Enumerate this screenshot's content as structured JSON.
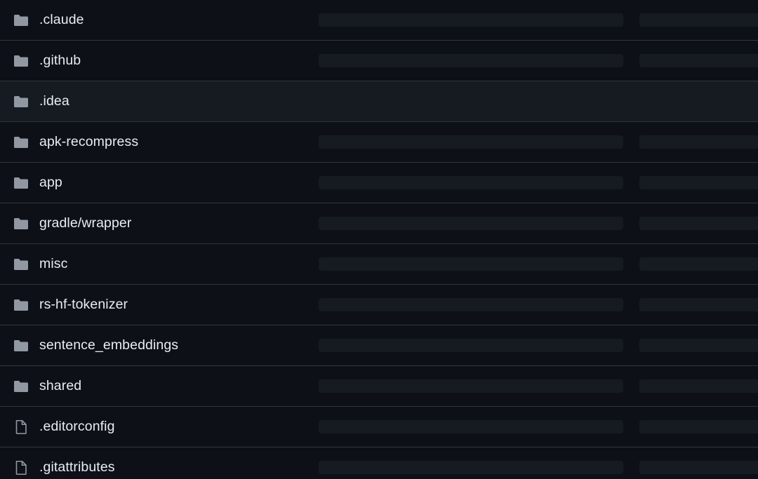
{
  "file_list": {
    "rows": [
      {
        "name": ".claude",
        "type": "folder",
        "icon": "folder-icon",
        "loading": true
      },
      {
        "name": ".github",
        "type": "folder",
        "icon": "folder-icon",
        "loading": true
      },
      {
        "name": ".idea",
        "type": "folder",
        "icon": "folder-icon",
        "loading": false,
        "hovered": true
      },
      {
        "name": "apk-recompress",
        "type": "folder",
        "icon": "folder-icon",
        "loading": true
      },
      {
        "name": "app",
        "type": "folder",
        "icon": "folder-icon",
        "loading": true
      },
      {
        "name": "gradle/wrapper",
        "type": "folder",
        "icon": "folder-icon",
        "loading": true
      },
      {
        "name": "misc",
        "type": "folder",
        "icon": "folder-icon",
        "loading": true
      },
      {
        "name": "rs-hf-tokenizer",
        "type": "folder",
        "icon": "folder-icon",
        "loading": true
      },
      {
        "name": "sentence_embeddings",
        "type": "folder",
        "icon": "folder-icon",
        "loading": true
      },
      {
        "name": "shared",
        "type": "folder",
        "icon": "folder-icon",
        "loading": true
      },
      {
        "name": ".editorconfig",
        "type": "file",
        "icon": "file-icon",
        "loading": true
      },
      {
        "name": ".gitattributes",
        "type": "file",
        "icon": "file-icon",
        "loading": true
      }
    ]
  },
  "colors": {
    "background": "#0d1117",
    "hover_background": "#161b22",
    "border": "#30363d",
    "text": "#e6edf3",
    "icon": "#9198a1",
    "skeleton": "#161b22"
  }
}
